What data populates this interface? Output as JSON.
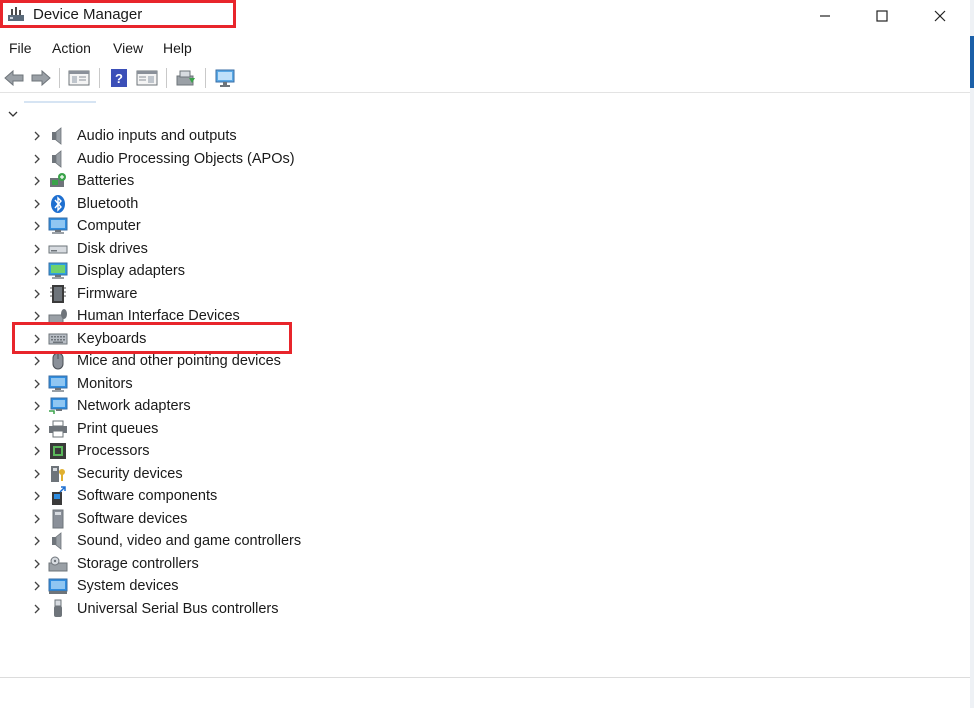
{
  "window": {
    "title": "Device Manager"
  },
  "menu": [
    "File",
    "Action",
    "View",
    "Help"
  ],
  "toolbar": [
    "back-icon",
    "forward-icon",
    "properties-icon",
    "help-icon",
    "show-hidden-icon",
    "update-driver-icon",
    "scan-hardware-icon"
  ],
  "tree": {
    "items": [
      {
        "label": "Audio inputs and outputs",
        "icon": "speaker-icon"
      },
      {
        "label": "Audio Processing Objects (APOs)",
        "icon": "speaker-icon"
      },
      {
        "label": "Batteries",
        "icon": "battery-icon"
      },
      {
        "label": "Bluetooth",
        "icon": "bluetooth-icon"
      },
      {
        "label": "Computer",
        "icon": "computer-icon"
      },
      {
        "label": "Disk drives",
        "icon": "disk-drive-icon"
      },
      {
        "label": "Display adapters",
        "icon": "display-adapter-icon"
      },
      {
        "label": "Firmware",
        "icon": "firmware-icon"
      },
      {
        "label": "Human Interface Devices",
        "icon": "hid-icon"
      },
      {
        "label": "Keyboards",
        "icon": "keyboard-icon"
      },
      {
        "label": "Mice and other pointing devices",
        "icon": "mouse-icon"
      },
      {
        "label": "Monitors",
        "icon": "monitor-icon"
      },
      {
        "label": "Network adapters",
        "icon": "network-adapter-icon"
      },
      {
        "label": "Print queues",
        "icon": "printer-icon"
      },
      {
        "label": "Processors",
        "icon": "processor-icon"
      },
      {
        "label": "Security devices",
        "icon": "security-device-icon"
      },
      {
        "label": "Software components",
        "icon": "software-component-icon"
      },
      {
        "label": "Software devices",
        "icon": "software-device-icon"
      },
      {
        "label": "Sound, video and game controllers",
        "icon": "sound-controller-icon"
      },
      {
        "label": "Storage controllers",
        "icon": "storage-controller-icon"
      },
      {
        "label": "System devices",
        "icon": "system-device-icon"
      },
      {
        "label": "Universal Serial Bus controllers",
        "icon": "usb-icon"
      }
    ]
  },
  "colors": {
    "highlight": "#e8252b",
    "accent": "#1a5fa8"
  }
}
